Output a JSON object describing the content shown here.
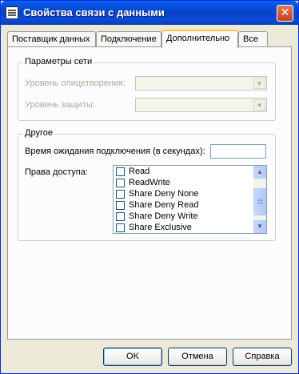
{
  "window": {
    "title": "Свойства связи с данными",
    "close_glyph": "✕"
  },
  "tabs": [
    {
      "label": "Поставщик данных"
    },
    {
      "label": "Подключение"
    },
    {
      "label": "Дополнительно",
      "active": true
    },
    {
      "label": "Все"
    }
  ],
  "network_group": {
    "title": "Параметры сети",
    "impersonation_label": "Уровень олицетворения:",
    "impersonation_value": "",
    "protection_label": "Уровень защиты:",
    "protection_value": ""
  },
  "other_group": {
    "title": "Другое",
    "timeout_label": "Время ожидания подключения (в секундах):",
    "timeout_value": "",
    "access_label": "Права доступа:",
    "access_options": [
      {
        "label": "Read",
        "checked": false
      },
      {
        "label": "ReadWrite",
        "checked": false
      },
      {
        "label": "Share Deny None",
        "checked": false
      },
      {
        "label": "Share Deny Read",
        "checked": false
      },
      {
        "label": "Share Deny Write",
        "checked": false
      },
      {
        "label": "Share Exclusive",
        "checked": false
      }
    ]
  },
  "buttons": {
    "ok": "OK",
    "cancel": "Отмена",
    "help": "Справка"
  }
}
